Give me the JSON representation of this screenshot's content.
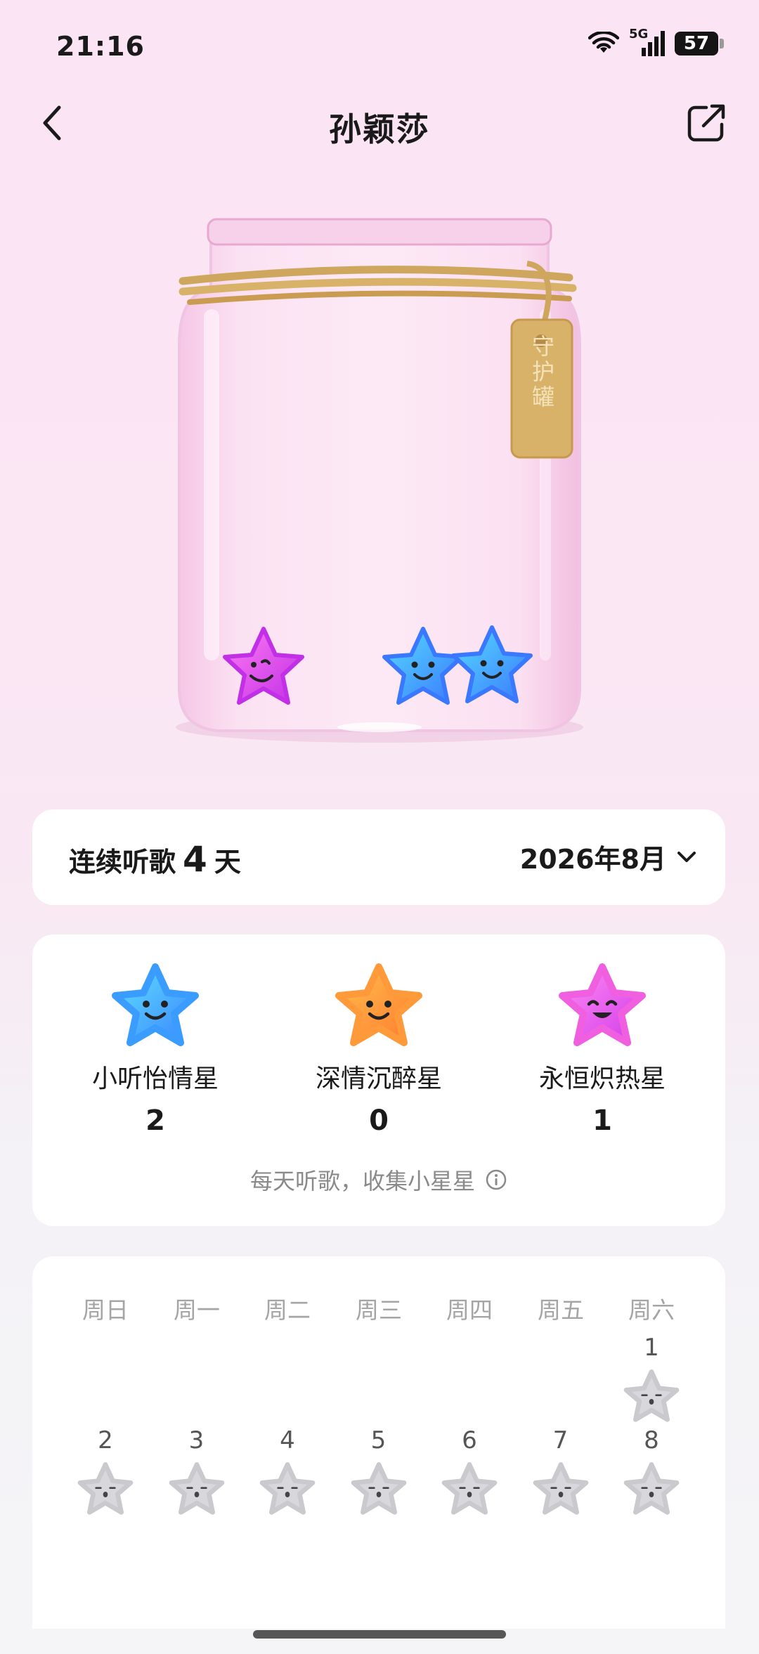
{
  "status_bar": {
    "time": "21:16",
    "network": "5G",
    "battery": "57"
  },
  "header": {
    "title": "孙颖莎",
    "back_icon": "chevron-left-icon",
    "share_icon": "share-icon"
  },
  "jar": {
    "tag_text": "守护罐",
    "stars_in_jar": [
      "pink-star",
      "blue-star",
      "blue-star"
    ]
  },
  "streak": {
    "prefix": "连续听歌",
    "days": "4",
    "suffix": "天",
    "month": "2026年8月"
  },
  "star_types": [
    {
      "label": "小听怡情星",
      "count": "2",
      "color": "#35b7f5"
    },
    {
      "label": "深情沉醉星",
      "count": "0",
      "color": "#ff9a3a"
    },
    {
      "label": "永恒炽热星",
      "count": "1",
      "color": "#ef5fe0"
    }
  ],
  "stars_tip": "每天听歌，收集小星星",
  "calendar": {
    "weekdays": [
      "周日",
      "周一",
      "周二",
      "周三",
      "周四",
      "周五",
      "周六"
    ],
    "days": [
      "1",
      "2",
      "3",
      "4",
      "5",
      "6",
      "7",
      "8"
    ]
  },
  "colors": {
    "accent_pink": "#ef5fe0",
    "accent_blue": "#35b7f5",
    "accent_orange": "#ff9a3a",
    "jar_tag": "#d9b26a"
  }
}
